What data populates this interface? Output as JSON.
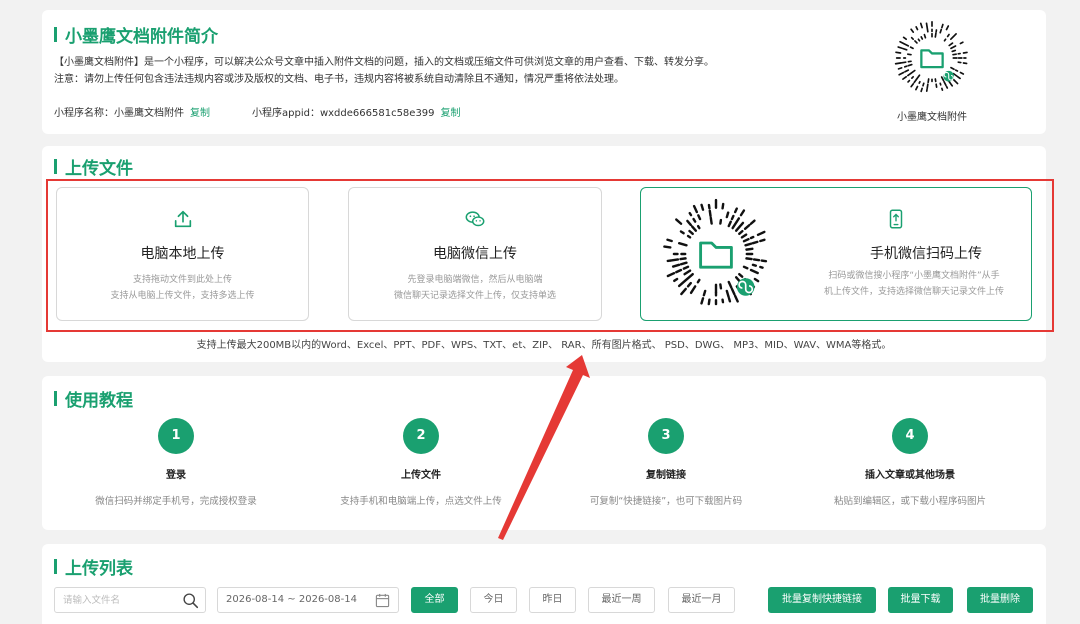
{
  "colors": {
    "accent": "#1aa070",
    "annotation": "#e53935"
  },
  "intro": {
    "title": "小墨鹰文档附件简介",
    "desc_line1": "【小墨鹰文档附件】是一个小程序，可以解决公众号文章中插入附件文档的问题，插入的文档或压缩文件可供浏览文章的用户查看、下载、转发分享。",
    "desc_line2": "注意：请勿上传任何包含违法违规内容或涉及版权的文档、电子书，违规内容将被系统自动清除且不通知，情况严重将依法处理。",
    "name_label": "小程序名称：",
    "name_value": "小墨鹰文档附件",
    "appid_label": "小程序appid：",
    "appid_value": "wxdde666581c58e399",
    "copy_label": "复制",
    "qr_caption": "小墨鹰文档附件",
    "qr_icon": "folder-icon"
  },
  "upload": {
    "title": "上传文件",
    "boxes": [
      {
        "icon": "upload-icon",
        "title": "电脑本地上传",
        "desc1": "支持拖动文件到此处上传",
        "desc2": "支持从电脑上传文件，支持多选上传"
      },
      {
        "icon": "wechat-icon",
        "title": "电脑微信上传",
        "desc1": "先登录电脑端微信，然后从电脑端",
        "desc2": "微信聊天记录选择文件上传，仅支持单选"
      },
      {
        "icon": "phone-upload-icon",
        "title": "手机微信扫码上传",
        "desc1": "扫码或微信搜小程序“小墨鹰文档附件”从手",
        "desc2": "机上传文件，支持选择微信聊天记录文件上传"
      }
    ],
    "formats": "支持上传最大200MB以内的Word、Excel、PPT、PDF、WPS、TXT、et、ZIP、 RAR、所有图片格式、 PSD、DWG、 MP3、MID、WAV、WMA等格式。"
  },
  "tutorial": {
    "title": "使用教程",
    "steps": [
      {
        "num": "1",
        "title": "登录",
        "desc": "微信扫码并绑定手机号，完成授权登录"
      },
      {
        "num": "2",
        "title": "上传文件",
        "desc": "支持手机和电脑端上传，点选文件上传"
      },
      {
        "num": "3",
        "title": "复制链接",
        "desc": "可复制“快捷链接”，也可下载图片码"
      },
      {
        "num": "4",
        "title": "插入文章或其他场景",
        "desc": "粘贴到编辑区，或下载小程序码图片"
      }
    ]
  },
  "list": {
    "title": "上传列表",
    "search_placeholder": "请输入文件名",
    "date_range": "2026-08-14 ~ 2026-08-14",
    "filters": [
      "全部",
      "今日",
      "昨日",
      "最近一周",
      "最近一月"
    ],
    "active_filter": "全部",
    "actions": [
      "批量复制快捷链接",
      "批量下载",
      "批量删除"
    ]
  }
}
